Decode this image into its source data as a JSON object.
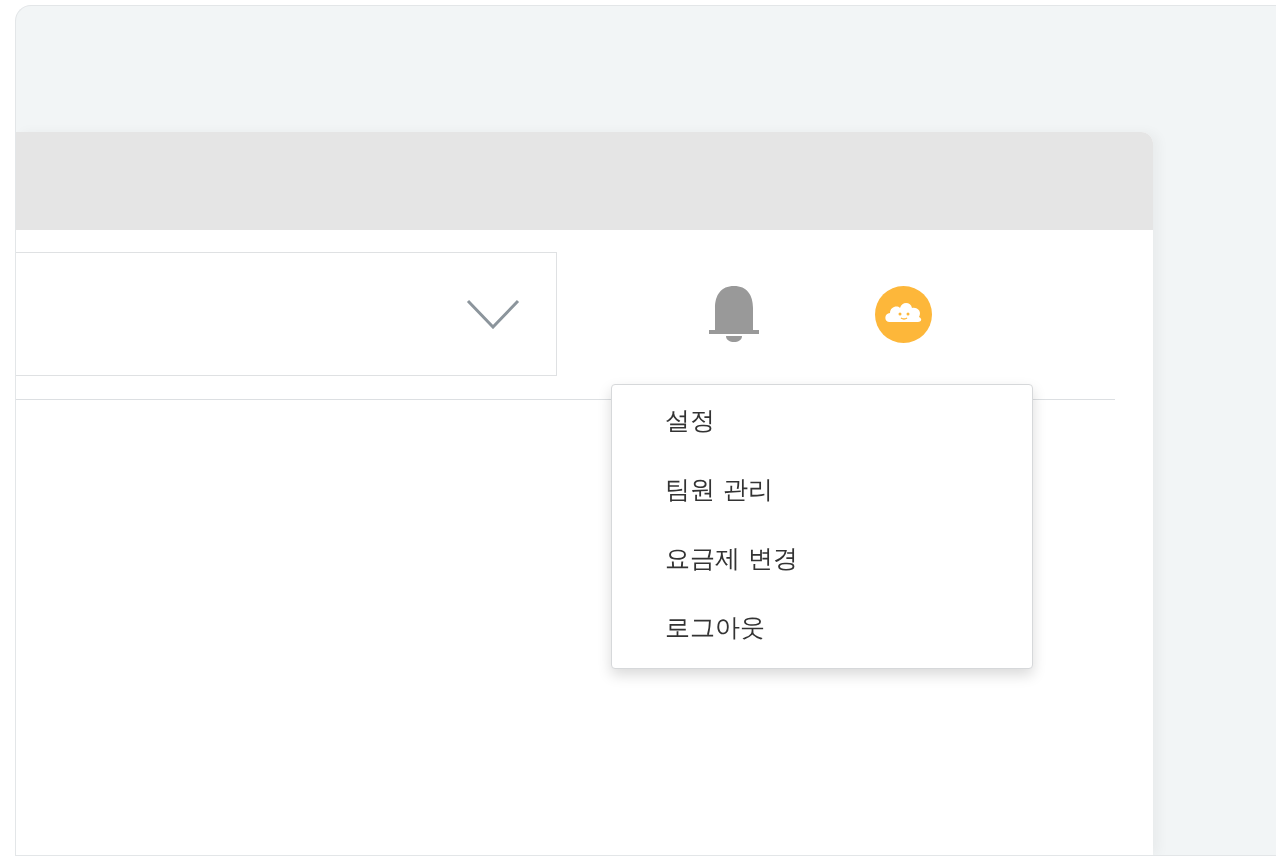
{
  "profile_menu": {
    "items": [
      {
        "label": "설정"
      },
      {
        "label": "팀원 관리"
      },
      {
        "label": "요금제 변경"
      },
      {
        "label": "로그아웃"
      }
    ]
  }
}
